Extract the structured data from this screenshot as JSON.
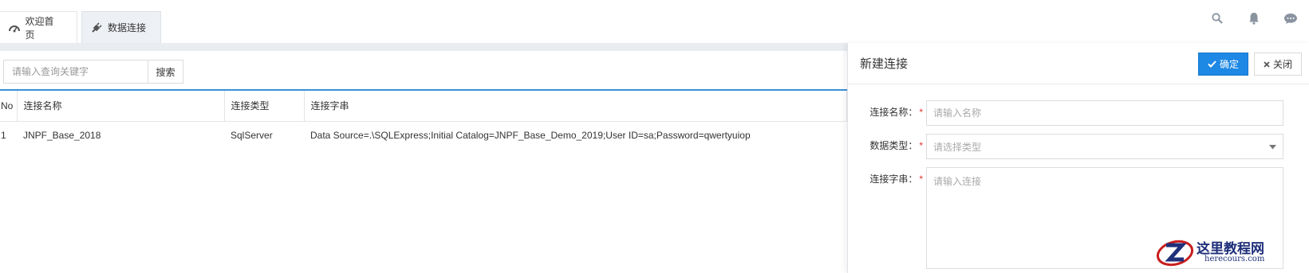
{
  "tabs": [
    {
      "label": "欢迎首页",
      "icon": "dashboard-icon"
    },
    {
      "label": "数据连接",
      "icon": "plug-icon",
      "active": true
    }
  ],
  "top_icons": [
    "search-icon",
    "bell-icon",
    "chat-icon"
  ],
  "search": {
    "placeholder": "请输入查询关键字",
    "button_label": "搜索"
  },
  "table": {
    "columns": [
      "No",
      "连接名称",
      "连接类型",
      "连接字串"
    ],
    "rows": [
      {
        "no": "1",
        "name": "JNPF_Base_2018",
        "type": "SqlServer",
        "connstr": "Data Source=.\\SQLExpress;Initial Catalog=JNPF_Base_Demo_2019;User ID=sa;Password=qwertyuiop"
      }
    ]
  },
  "panel": {
    "title": "新建连接",
    "ok_label": "确定",
    "close_label": "关闭",
    "fields": {
      "name": {
        "label": "连接名称：",
        "placeholder": "请输入名称"
      },
      "type": {
        "label": "数据类型：",
        "placeholder": "请选择类型"
      },
      "connstr": {
        "label": "连接字串：",
        "placeholder": "请输入连接"
      }
    }
  },
  "watermark": {
    "line1": "这里教程网",
    "line2": "herecours.com"
  },
  "colors": {
    "accent": "#1e88e5",
    "required": "#e0342c",
    "brand": "#1f2f7a"
  }
}
